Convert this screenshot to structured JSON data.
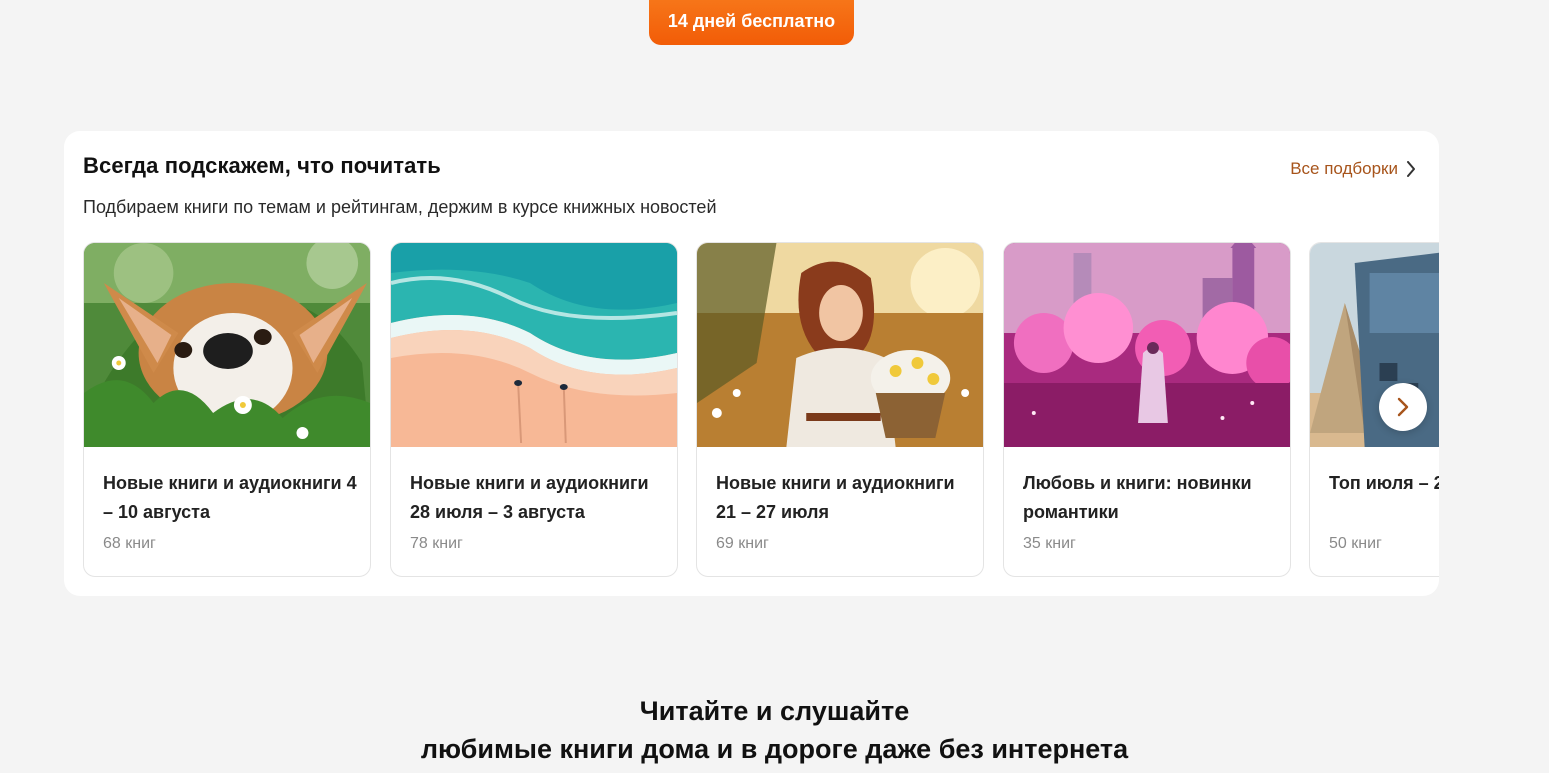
{
  "cta": {
    "label": "14 дней бесплатно"
  },
  "section": {
    "title": "Всегда подскажем, что почитать",
    "subtitle": "Подбираем книги по темам и рейтингам, держим в курсе книжных новостей",
    "all_link": "Все подборки"
  },
  "cards": [
    {
      "title": "Новые книги и аудиокниги 4 – 10 августа",
      "count": "68 книг",
      "image": "corgi-in-grass"
    },
    {
      "title": "Новые книги и аудиокниги 28 июля – 3 августа",
      "count": "78 книг",
      "image": "beach-aerial"
    },
    {
      "title": "Новые книги и аудиокниги 21 – 27 июля",
      "count": "69 книг",
      "image": "woman-with-flowers"
    },
    {
      "title": "Любовь и книги: новинки романтики",
      "count": "35 книг",
      "image": "pink-fantasy-city"
    },
    {
      "title": "Топ июля – 2",
      "count": "50 книг",
      "image": "book-cover-pyramids"
    }
  ],
  "bottom": {
    "line1": "Читайте и слушайте",
    "line2": "любимые книги дома и в дороге даже без интернета"
  },
  "colors": {
    "accent": "#f25c07",
    "link": "#a7541b"
  }
}
